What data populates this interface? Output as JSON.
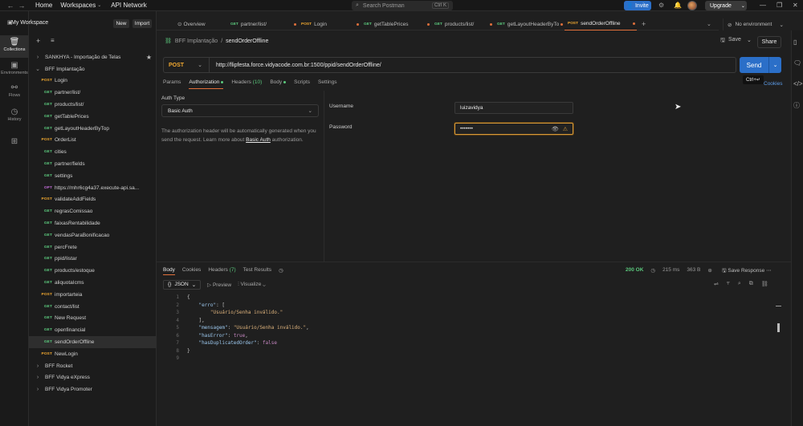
{
  "topbar": {
    "home": "Home",
    "workspaces": "Workspaces",
    "api_network": "API Network",
    "search_placeholder": "Search Postman",
    "search_shortcut": "Ctrl K",
    "invite": "Invite",
    "upgrade": "Upgrade"
  },
  "rail": [
    {
      "label": "Collections",
      "icon": "collections-icon"
    },
    {
      "label": "Environments",
      "icon": "environments-icon"
    },
    {
      "label": "Flows",
      "icon": "flows-icon"
    },
    {
      "label": "History",
      "icon": "history-icon"
    }
  ],
  "sidebar": {
    "workspace": "My Workspace",
    "new": "New",
    "import": "Import",
    "items": [
      {
        "level": 0,
        "label": "SANKHYA - Importação de Telas",
        "collapsed": true,
        "starred": true
      },
      {
        "level": 0,
        "label": "BFF Implantação",
        "collapsed": false
      },
      {
        "level": 1,
        "method": "POST",
        "label": "Login"
      },
      {
        "level": 1,
        "method": "GET",
        "label": "partner/list/"
      },
      {
        "level": 1,
        "method": "GET",
        "label": "products/list/"
      },
      {
        "level": 1,
        "method": "GET",
        "label": "getTablePrices"
      },
      {
        "level": 1,
        "method": "GET",
        "label": "getLayoutHeaderByTop"
      },
      {
        "level": 1,
        "method": "POST",
        "label": "OrderList"
      },
      {
        "level": 1,
        "method": "GET",
        "label": "cities"
      },
      {
        "level": 1,
        "method": "GET",
        "label": "partner/fields"
      },
      {
        "level": 1,
        "method": "GET",
        "label": "settings"
      },
      {
        "level": 1,
        "method": "OPT",
        "label": "https://mhr6cg4a37.execute-api.sa..."
      },
      {
        "level": 1,
        "method": "POST",
        "label": "validateAddFields"
      },
      {
        "level": 1,
        "method": "GET",
        "label": "regrasComissao"
      },
      {
        "level": 1,
        "method": "GET",
        "label": "faixasRentabilidade"
      },
      {
        "level": 1,
        "method": "GET",
        "label": "vendasParaBonificacao"
      },
      {
        "level": 1,
        "method": "GET",
        "label": "percFrete"
      },
      {
        "level": 1,
        "method": "GET",
        "label": "ppid/listar"
      },
      {
        "level": 1,
        "method": "GET",
        "label": "products/estoque"
      },
      {
        "level": 1,
        "method": "GET",
        "label": "aliquotaIcms"
      },
      {
        "level": 1,
        "method": "POST",
        "label": "importarteia"
      },
      {
        "level": 1,
        "method": "GET",
        "label": "contact/list"
      },
      {
        "level": 1,
        "method": "GET",
        "label": "New Request"
      },
      {
        "level": 1,
        "method": "GET",
        "label": "openfinancial"
      },
      {
        "level": 1,
        "method": "GET",
        "label": "sendOrderOffline",
        "selected": true
      },
      {
        "level": 1,
        "method": "POST",
        "label": "NewLogin"
      },
      {
        "level": 0,
        "label": "BFF Rocket",
        "collapsed": true
      },
      {
        "level": 0,
        "label": "BFF Vidya eXpress",
        "collapsed": true
      },
      {
        "level": 0,
        "label": "BFF Vidya Promoter",
        "collapsed": true
      }
    ]
  },
  "tabs": [
    {
      "method": "",
      "label": "Overview"
    },
    {
      "method": "GET",
      "label": "partner/list/"
    },
    {
      "method": "POST",
      "label": "Login"
    },
    {
      "method": "GET",
      "label": "getTablePrices"
    },
    {
      "method": "GET",
      "label": "products/list/"
    },
    {
      "method": "GET",
      "label": "getLayoutHeaderByTo"
    },
    {
      "method": "POST",
      "label": "sendOrderOffline",
      "active": true
    }
  ],
  "environment": "No environment",
  "request": {
    "breadcrumb_parent": "BFF Implantação",
    "breadcrumb_current": "sendOrderOffline",
    "save": "Save",
    "share": "Share",
    "method": "POST",
    "url": "http://flipfesta.force.vidyacode.com.br:1500/ppid/sendOrderOffline/",
    "send": "Send",
    "tooltip": "Ctrl+↵",
    "cookies": "Cookies",
    "subtabs": [
      "Params",
      "Authorization",
      "Headers",
      "(10)",
      "Body",
      "Scripts",
      "Settings"
    ]
  },
  "auth": {
    "type_label": "Auth Type",
    "type_value": "Basic Auth",
    "note_1": "The authorization header will be automatically generated when you send the request. Learn more about ",
    "note_link": "Basic Auth",
    "note_2": " authorization.",
    "username_label": "Username",
    "username_value": "luizavidya",
    "password_label": "Password",
    "password_value": "•••••••"
  },
  "response": {
    "tabs": [
      "Body",
      "Cookies",
      "Headers",
      "(7)",
      "Test Results"
    ],
    "status": "200 OK",
    "time": "215 ms",
    "size": "363 B",
    "save_response": "Save Response",
    "format": "JSON",
    "preview": "Preview",
    "visualize": "Visualize",
    "lines": [
      "1",
      "2",
      "3",
      "4",
      "5",
      "6",
      "7",
      "8",
      "9"
    ],
    "code": {
      "l1": "{",
      "l2_key": "\"erro\"",
      "l2_rest": ": [",
      "l3_val": "\"Usuário/Senha inválido.\"",
      "l4": "],",
      "l5_key": "\"mensagem\"",
      "l5_val": "\"Usuário/Senha inválido.\"",
      "l6_key": "\"hasError\"",
      "l6_val": "true",
      "l7_key": "\"hasDuplicatedOrder\"",
      "l7_val": "false",
      "l8": "}"
    }
  }
}
